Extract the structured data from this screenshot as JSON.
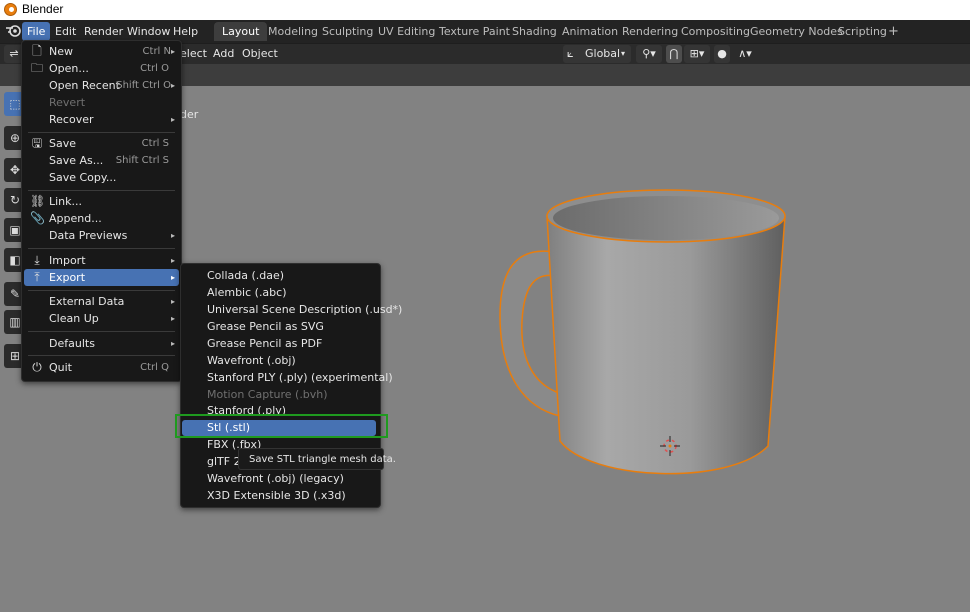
{
  "window": {
    "title": "Blender"
  },
  "menubar": {
    "items": [
      "File",
      "Edit",
      "Render",
      "Window",
      "Help"
    ]
  },
  "workspaces": [
    "Layout",
    "Modeling",
    "Sculpting",
    "UV Editing",
    "Texture Paint",
    "Shading",
    "Animation",
    "Rendering",
    "Compositing",
    "Geometry Nodes",
    "Scripting"
  ],
  "add_workspace": "+",
  "header": {
    "select_label": "elect",
    "add_label": "Add",
    "object_label": "Object",
    "orientation": "Global"
  },
  "viewport": {
    "overlay_text": "der"
  },
  "file_menu": {
    "items": [
      {
        "label": "New",
        "shortcut": "Ctrl N",
        "icon": "new-file-icon",
        "submenu": true
      },
      {
        "label": "Open...",
        "shortcut": "Ctrl O",
        "icon": "folder-icon"
      },
      {
        "label": "Open Recent",
        "shortcut": "Shift Ctrl O",
        "submenu": true
      },
      {
        "label": "Revert",
        "disabled": true
      },
      {
        "label": "Recover",
        "submenu": true
      },
      {
        "label": "Save",
        "shortcut": "Ctrl S",
        "icon": "save-icon"
      },
      {
        "label": "Save As...",
        "shortcut": "Shift Ctrl S"
      },
      {
        "label": "Save Copy..."
      },
      {
        "label": "Link...",
        "icon": "link-icon"
      },
      {
        "label": "Append...",
        "icon": "append-icon"
      },
      {
        "label": "Data Previews",
        "submenu": true
      },
      {
        "label": "Import",
        "icon": "import-icon",
        "submenu": true
      },
      {
        "label": "Export",
        "icon": "export-icon",
        "submenu": true,
        "highlighted": true
      },
      {
        "label": "External Data",
        "submenu": true
      },
      {
        "label": "Clean Up",
        "submenu": true
      },
      {
        "label": "Defaults",
        "submenu": true
      },
      {
        "label": "Quit",
        "shortcut": "Ctrl Q",
        "icon": "power-icon"
      }
    ]
  },
  "export_menu": {
    "items": [
      {
        "label": "Collada (.dae)"
      },
      {
        "label": "Alembic (.abc)"
      },
      {
        "label": "Universal Scene Description (.usd*)"
      },
      {
        "label": "Grease Pencil as SVG"
      },
      {
        "label": "Grease Pencil as PDF"
      },
      {
        "label": "Wavefront (.obj)"
      },
      {
        "label": "Stanford PLY (.ply) (experimental)"
      },
      {
        "label": "Motion Capture (.bvh)",
        "disabled": true
      },
      {
        "label": "Stanford (.ply)"
      },
      {
        "label": "Stl (.stl)",
        "highlighted": true
      },
      {
        "label": "FBX (.fbx)"
      },
      {
        "label": "glTF 2.0"
      },
      {
        "label": "Wavefront (.obj) (legacy)"
      },
      {
        "label": "X3D Extensible 3D (.x3d)"
      }
    ]
  },
  "tooltip": {
    "text": "Save STL triangle mesh data."
  },
  "colors": {
    "accent": "#4772b3",
    "highlight_box": "#1f9a1f",
    "selection_outline": "#e87d0d"
  }
}
